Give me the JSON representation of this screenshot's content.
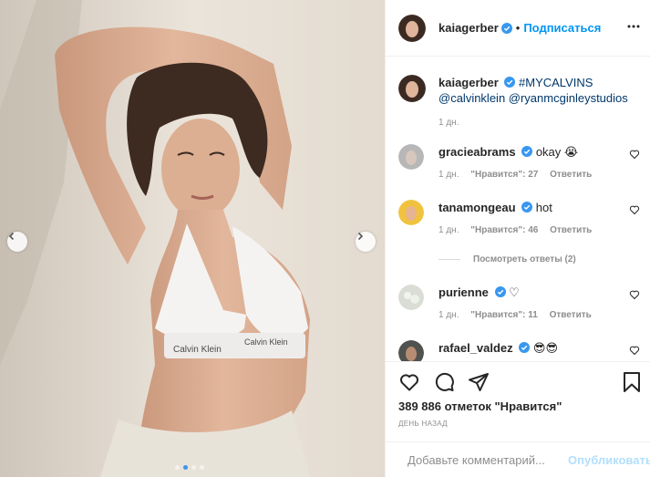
{
  "post": {
    "author": "kaiagerber",
    "follow_label": "Подписаться",
    "separator": "•",
    "caption_hashtag": "#MYCALVINS",
    "caption_mentions": "@calvinklein @ryanmcginleystudios",
    "caption_time": "1 дн.",
    "brand_text_left": "Calvin Klein",
    "brand_text_right": "Calvin Klein"
  },
  "comments": [
    {
      "user": "gracieabrams",
      "text": "okay 😭",
      "time": "1 дн.",
      "likes": "\"Нравится\": 27",
      "reply": "Ответить"
    },
    {
      "user": "tanamongeau",
      "text": "hot",
      "time": "1 дн.",
      "likes": "\"Нравится\": 46",
      "reply": "Ответить"
    },
    {
      "user": "purienne",
      "text": "♡",
      "time": "1 дн.",
      "likes": "\"Нравится\": 11",
      "reply": "Ответить"
    },
    {
      "user": "rafael_valdez",
      "text": "😎😎"
    }
  ],
  "view_replies": "Посмотреть ответы (2)",
  "likes_count": "389 886 отметок \"Нравится\"",
  "date_label": "ДЕНЬ НАЗАД",
  "add_comment": {
    "placeholder": "Добавьте комментарий...",
    "post_label": "Опубликовать"
  },
  "colors": {
    "accent": "#0095f6",
    "verified": "#3897f0",
    "text": "#262626",
    "muted": "#8e8e8e"
  },
  "icons": [
    "chevron-left-icon",
    "chevron-right-icon",
    "more-icon",
    "heart-icon",
    "comment-icon",
    "share-icon",
    "bookmark-icon",
    "emoji-icon",
    "verified-icon"
  ]
}
